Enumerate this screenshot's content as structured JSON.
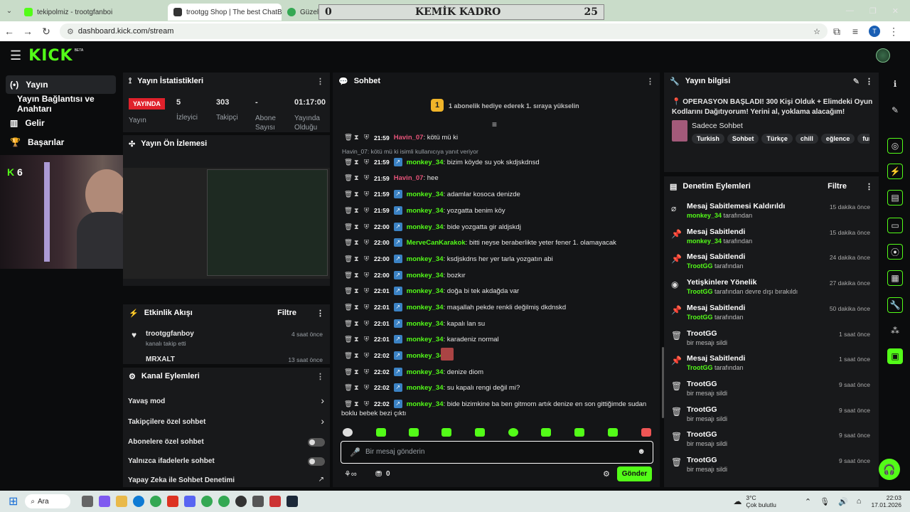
{
  "browser": {
    "tabs": [
      {
        "title": "tekipolmiz - trootgfanboi",
        "active": false,
        "color": "#53fc18"
      },
      {
        "title": "trootgg Shop | The best ChatB",
        "active": true,
        "color": "#333333"
      },
      {
        "title": "Güzelce... plajı - Google Ha",
        "active": false,
        "color": "#34a853"
      }
    ],
    "url": "dashboard.kick.com/stream",
    "overlay_left": "0",
    "overlay_title": "KEMİK KADRO",
    "overlay_right": "25",
    "profile": "T"
  },
  "kick": {
    "logo": "KICK",
    "logo_beta": "BETA"
  },
  "left_nav": {
    "items": [
      {
        "label": "Yayın",
        "icon": "broadcast-icon",
        "active": true
      },
      {
        "label": "Yayın Bağlantısı ve Anahtarı",
        "icon": "",
        "active": false
      },
      {
        "label": "Gelir",
        "icon": "chart-icon",
        "active": false
      },
      {
        "label": "Başarılar",
        "icon": "trophy-icon",
        "active": false
      }
    ],
    "webcam_badge": "6"
  },
  "stats": {
    "title": "Yayın İstatistikleri",
    "live": "YAYINDA",
    "live_label": "Yayın",
    "viewers": "5",
    "viewers_label": "İzleyici",
    "followers": "303",
    "followers_label": "Takipçi",
    "subs": "-",
    "subs_label": "Abone Sayısı",
    "duration": "01:17:00",
    "duration_label": "Yayında Olduğu"
  },
  "preview": {
    "title": "Yayın Ön İzlemesi"
  },
  "activity": {
    "title": "Etkinlik Akışı",
    "filter": "Filtre",
    "items": [
      {
        "name": "trootggfanboy",
        "sub": "kanalı takip etti",
        "time": "4 saat önce"
      },
      {
        "name": "MRXALT",
        "sub": "",
        "time": "13 saat önce"
      }
    ]
  },
  "channel_actions": {
    "title": "Kanal Eylemleri",
    "items": [
      {
        "label": "Yavaş mod",
        "kind": "arrow"
      },
      {
        "label": "Takipçilere özel sohbet",
        "kind": "arrow"
      },
      {
        "label": "Abonelere özel sohbet",
        "kind": "toggle"
      },
      {
        "label": "Yalnızca ifadelerle sohbet",
        "kind": "toggle"
      },
      {
        "label": "Yapay Zeka ile Sohbet Denetimi",
        "kind": "link"
      }
    ]
  },
  "chat": {
    "title": "Sohbet",
    "goal_badge": "1",
    "goal_text": "1 abonelik hediye ederek 1. sıraya yükselin",
    "reply_hint": "Havin_07: kötü mü ki isimli kullanıcıya yanıt veriyor",
    "messages": [
      {
        "time": "21:59",
        "user": "Havin_07",
        "color": "#e8547a",
        "text": "kötü mü ki",
        "badge": false
      },
      {
        "time": "21:59",
        "user": "monkey_34",
        "color": "#53fc18",
        "text": "bizim köyde su yok skdjskdnsd",
        "badge": true
      },
      {
        "time": "21:59",
        "user": "Havin_07",
        "color": "#e8547a",
        "text": "hee",
        "badge": false
      },
      {
        "time": "21:59",
        "user": "monkey_34",
        "color": "#53fc18",
        "text": "adamlar kosoca denizde",
        "badge": true
      },
      {
        "time": "21:59",
        "user": "monkey_34",
        "color": "#53fc18",
        "text": "yozgatta benim köy",
        "badge": true
      },
      {
        "time": "22:00",
        "user": "monkey_34",
        "color": "#53fc18",
        "text": "bide yozgatta gir aldjskdj",
        "badge": true
      },
      {
        "time": "22:00",
        "user": "MerveCanKarakok",
        "color": "#53fc18",
        "text": "bitti neyse beraberlikte yeter fener 1. olamayacak",
        "badge": true
      },
      {
        "time": "22:00",
        "user": "monkey_34",
        "color": "#53fc18",
        "text": "ksdjskdns her yer tarla yozgatın abi",
        "badge": true
      },
      {
        "time": "22:00",
        "user": "monkey_34",
        "color": "#53fc18",
        "text": "bozkır",
        "badge": true
      },
      {
        "time": "22:01",
        "user": "monkey_34",
        "color": "#53fc18",
        "text": "doğa bi tek akdağda var",
        "badge": true
      },
      {
        "time": "22:01",
        "user": "monkey_34",
        "color": "#53fc18",
        "text": "maşallah pekde renkli değilmiş dkdnskd",
        "badge": true
      },
      {
        "time": "22:01",
        "user": "monkey_34",
        "color": "#53fc18",
        "text": "kapalı lan su",
        "badge": true
      },
      {
        "time": "22:01",
        "user": "monkey_34",
        "color": "#53fc18",
        "text": "karadeniz normal",
        "badge": true
      },
      {
        "time": "22:02",
        "user": "monkey_34",
        "color": "#53fc18",
        "text": "",
        "badge": true
      },
      {
        "time": "22:02",
        "user": "monkey_34",
        "color": "#53fc18",
        "text": "denize diom",
        "badge": true
      },
      {
        "time": "22:02",
        "user": "monkey_34",
        "color": "#53fc18",
        "text": "su kapalı rengi değil mi?",
        "badge": true
      },
      {
        "time": "22:02",
        "user": "monkey_34",
        "color": "#53fc18",
        "text": "bide bizimkine ba ben gitmom artık denize en son gittiğimde sudan",
        "badge": true
      }
    ],
    "last_wrap": "boklu bebek bezi çıktı",
    "input_placeholder": "Bir mesaj gönderin",
    "points": "0",
    "send": "Gönder"
  },
  "stream_info": {
    "title": "Yayın bilgisi",
    "headline": "OPERASYON BAŞLADI! 300 Kişi Olduk + Elimdeki Oyun Kodlarını Dağıtıyorum! Yerini al, yoklama alacağım!",
    "category": "Sadece Sohbet",
    "tags": [
      "Turkish",
      "Sohbet",
      "Türkçe",
      "chill",
      "eğlence",
      "funny"
    ]
  },
  "moderation": {
    "title": "Denetim Eylemleri",
    "filter": "Filtre",
    "items": [
      {
        "icon": "unpin-icon",
        "title": "Mesaj Sabitlemesi Kaldırıldı",
        "user": "monkey_34",
        "suffix": "tarafından",
        "time": "15 dakika önce"
      },
      {
        "icon": "pin-icon",
        "title": "Mesaj Sabitlendi",
        "user": "monkey_34",
        "suffix": "tarafından",
        "time": "15 dakika önce"
      },
      {
        "icon": "pin-icon",
        "title": "Mesaj Sabitlendi",
        "user": "TrootGG",
        "suffix": "tarafından",
        "time": "24 dakika önce"
      },
      {
        "icon": "eye-icon",
        "title": "Yetişkinlere Yönelik",
        "user": "TrootGG",
        "suffix": "tarafından devre dışı bırakıldı",
        "time": "27 dakika önce"
      },
      {
        "icon": "pin-icon",
        "title": "Mesaj Sabitlendi",
        "user": "TrootGG",
        "suffix": "tarafından",
        "time": "50 dakika önce"
      },
      {
        "icon": "trash-icon",
        "title": "TrootGG",
        "user": "",
        "suffix": "bir mesajı sildi",
        "time": "1 saat önce"
      },
      {
        "icon": "pin-icon",
        "title": "Mesaj Sabitlendi",
        "user": "TrootGG",
        "suffix": "tarafından",
        "time": "1 saat önce"
      },
      {
        "icon": "trash-icon",
        "title": "TrootGG",
        "user": "",
        "suffix": "bir mesajı sildi",
        "time": "9 saat önce"
      },
      {
        "icon": "trash-icon",
        "title": "TrootGG",
        "user": "",
        "suffix": "bir mesajı sildi",
        "time": "9 saat önce"
      },
      {
        "icon": "trash-icon",
        "title": "TrootGG",
        "user": "",
        "suffix": "bir mesajı sildi",
        "time": "9 saat önce"
      },
      {
        "icon": "trash-icon",
        "title": "TrootGG",
        "user": "",
        "suffix": "bir mesajı sildi",
        "time": "9 saat önce"
      }
    ]
  },
  "taskbar": {
    "search": "Ara",
    "weather_temp": "3°C",
    "weather_desc": "Çok bulutlu",
    "time": "22:03",
    "date": "17.01.2026"
  },
  "colors": {
    "accent": "#53fc18",
    "live": "#e0212b",
    "panel": "#18191b",
    "bg": "#0b0c0d"
  }
}
